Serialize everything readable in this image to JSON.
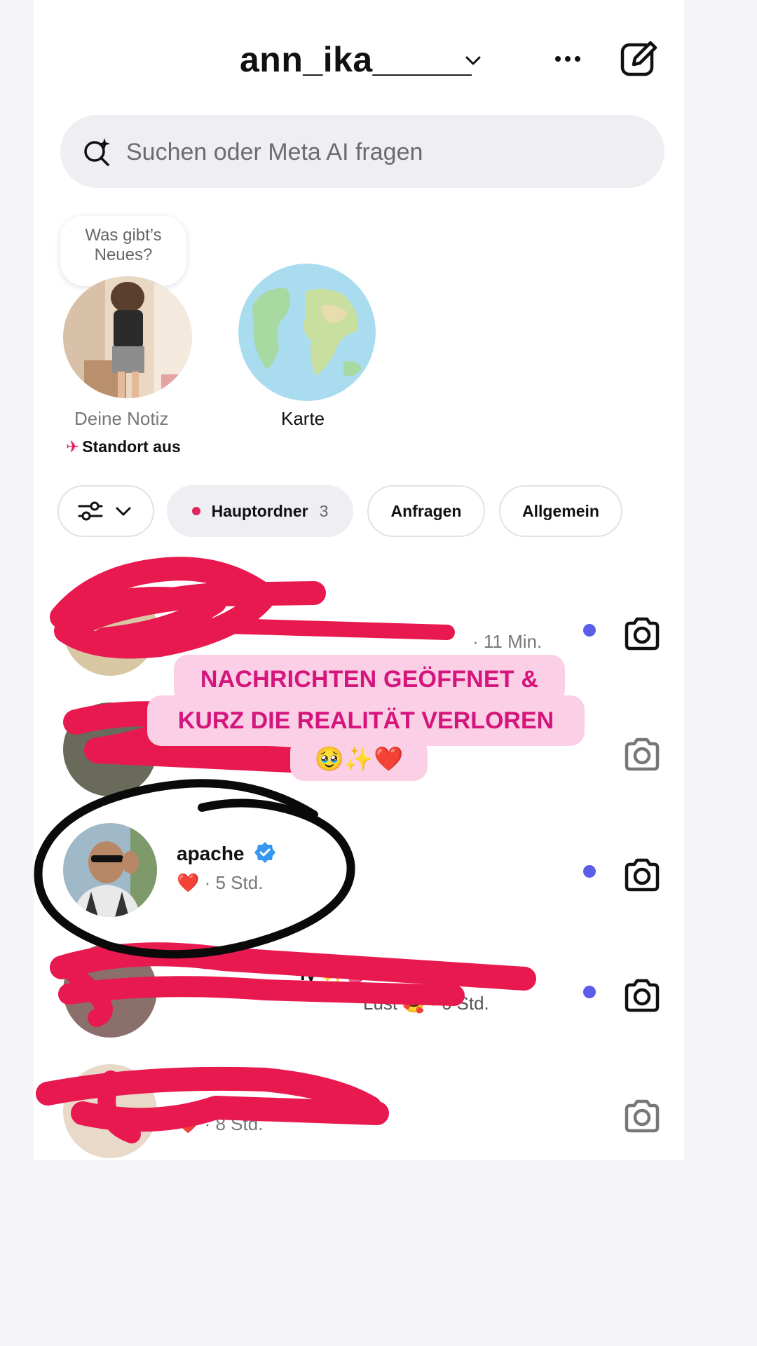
{
  "header": {
    "username": "ann_ika_____",
    "more_icon": "more-horizontal-icon",
    "compose_icon": "new-message-icon"
  },
  "search": {
    "placeholder": "Suchen oder Meta AI fragen",
    "icon": "meta-ai-search-icon"
  },
  "notes": {
    "my_note_prompt": "Was gibt’s Neues?",
    "my_note_label": "Deine Notiz",
    "location_status": "Standort aus",
    "map_label": "Karte"
  },
  "filters": {
    "chips": [
      {
        "label": "Hauptordner",
        "count": "3",
        "active": true
      },
      {
        "label": "Anfragen"
      },
      {
        "label": "Allgemein"
      }
    ]
  },
  "threads": [
    {
      "name": "",
      "preview": "· 11 Min.",
      "unread": true
    },
    {
      "name": "",
      "preview": "",
      "unread": false
    },
    {
      "name": "apache",
      "verified": true,
      "preview_emoji": "❤️",
      "preview": "· 5 Std.",
      "unread": true
    },
    {
      "name": "ly ✨💕",
      "preview": "Lust 🥰 · 6 Std.",
      "unread": true
    },
    {
      "name": "",
      "preview_emoji": "❤️",
      "preview": "· 8 Std.",
      "unread": false
    }
  ],
  "story_sticker": {
    "line1": "NACHRICHTEN GEÖFFNET &",
    "line2": "KURZ DIE REALITÄT VERLOREN",
    "line3": "🥹✨❤️"
  },
  "colors": {
    "unread_dot": "#5b5ee8",
    "scribble_red": "#e8194f",
    "sticker_bg": "#fbcfe6",
    "sticker_text": "#d4157c",
    "verified_blue": "#3797f0"
  }
}
